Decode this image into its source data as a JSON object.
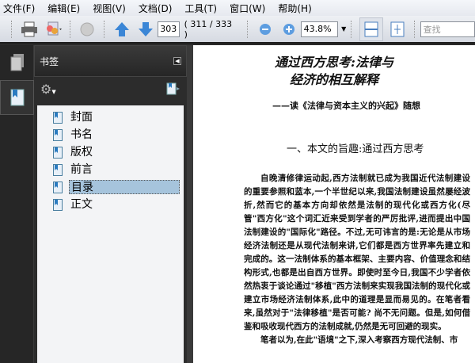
{
  "menu": [
    "文件(F)",
    "编辑(E)",
    "视图(V)",
    "文档(D)",
    "工具(T)",
    "窗口(W)",
    "帮助(H)"
  ],
  "toolbar": {
    "page_current": "303",
    "page_count": "( 311 / 333 )",
    "zoom": "43.8%",
    "search_placeholder": "查找"
  },
  "panel": {
    "title": "书签",
    "bookmarks": [
      {
        "label": "封面"
      },
      {
        "label": "书名"
      },
      {
        "label": "版权"
      },
      {
        "label": "前言"
      },
      {
        "label": "目录",
        "selected": true
      },
      {
        "label": "正文"
      }
    ]
  },
  "document": {
    "title_line1": "通过西方思考:法律与",
    "title_line2": "经济的相互解释",
    "subtitle": "——读《法律与资本主义的兴起》随想",
    "section_heading": "一、本文的旨趣:通过西方思考",
    "paragraph1": "自晚清修律运动起,西方法制就已成为我国近代法制建设的重要参照和蓝本,一个半世纪以来,我国法制建设虽然屡经波折,然而它的基本方向却依然是法制的现代化或西方化(尽管\"西方化\"这个词汇近来受到学者的严厉批评,进而提出中国法制建设的\"国际化\"路径。不过,无可讳言的是:无论是从市场经济法制还是从现代法制来讲,它们都是西方世界率先建立和完成的。这一法制体系的基本框架、主要内容、价值理念和结构形式,也都是出自西方世界。即使时至今日,我国不少学者依然热衷于谈论通过\"移植\"西方法制来实现我国法制的现代化或建立市场经济法制体系,此中的道理是显而易见的。在笔者看来,虽然对于\"法律移植\"是否可能? 尚不无问题。但是,如何借鉴和吸收现代西方的法制成就,仍然是无可回避的现实。",
    "paragraph2": "笔者以为,在此\"语境\"之下,深入考察西方现代法制、市"
  }
}
